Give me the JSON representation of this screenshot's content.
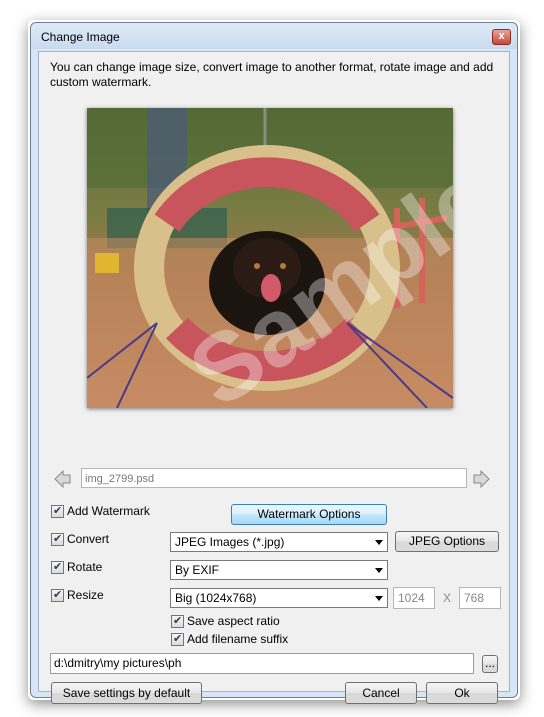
{
  "window": {
    "title": "Change Image",
    "close_label": "x"
  },
  "description": "You can change image size, convert image to another format, rotate image and add custom watermark.",
  "preview": {
    "watermark_text": "Sample"
  },
  "file": {
    "name": "img_2799.psd"
  },
  "options": {
    "add_watermark": {
      "label": "Add Watermark",
      "checked": true,
      "button": "Watermark Options"
    },
    "convert": {
      "label": "Convert",
      "checked": true,
      "format": "JPEG Images  (*.jpg)",
      "button": "JPEG Options"
    },
    "rotate": {
      "label": "Rotate",
      "checked": true,
      "value": "By EXIF"
    },
    "resize": {
      "label": "Resize",
      "checked": true,
      "value": "Big (1024x768)",
      "width": "1024",
      "x_sep": "X",
      "height": "768"
    },
    "save_aspect": {
      "label": "Save aspect ratio",
      "checked": true
    },
    "add_suffix": {
      "label": "Add filename suffix",
      "checked": true
    }
  },
  "output_path": {
    "value": "d:\\dmitry\\my pictures\\ph",
    "browse_label": "..."
  },
  "footer": {
    "save_default": "Save settings by default",
    "cancel": "Cancel",
    "ok": "Ok"
  }
}
